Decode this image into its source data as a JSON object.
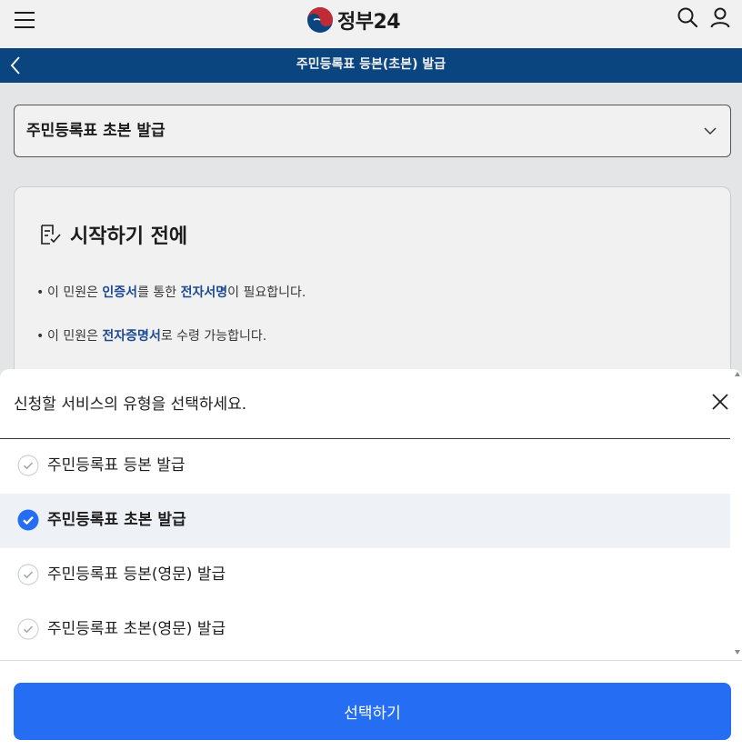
{
  "header": {
    "logo_text": "정부24"
  },
  "title_bar": {
    "title": "주민등록표 등본(초본) 발급"
  },
  "service_select": {
    "selected": "주민등록표 초본 발급"
  },
  "info_card": {
    "heading": "시작하기 전에",
    "notice_1": {
      "pre": "이 민원은 ",
      "em1": "인증서",
      "mid": "를 통한 ",
      "em2": "전자서명",
      "post": "이 필요합니다."
    },
    "notice_2": {
      "pre": "이 민원은 ",
      "em1": "전자증명서",
      "post": "로 수령 가능합니다."
    }
  },
  "sheet": {
    "title": "신청할 서비스의 유형을 선택하세요.",
    "options": [
      {
        "label": "주민등록표 등본 발급",
        "selected": false
      },
      {
        "label": "주민등록표 초본 발급",
        "selected": true
      },
      {
        "label": "주민등록표 등본(영문) 발급",
        "selected": false
      },
      {
        "label": "주민등록표 초본(영문) 발급",
        "selected": false
      }
    ],
    "confirm_label": "선택하기"
  },
  "colors": {
    "title_bar": "#0b4a88",
    "accent": "#256ef4",
    "emphasis_text": "#1d4f9a",
    "selected_row": "#eef1f5"
  },
  "icons": [
    "menu-icon",
    "gov-logo-icon",
    "search-icon",
    "user-icon",
    "back-arrow-icon",
    "chevron-down-icon",
    "checklist-icon",
    "close-icon",
    "check-circle-icon"
  ]
}
